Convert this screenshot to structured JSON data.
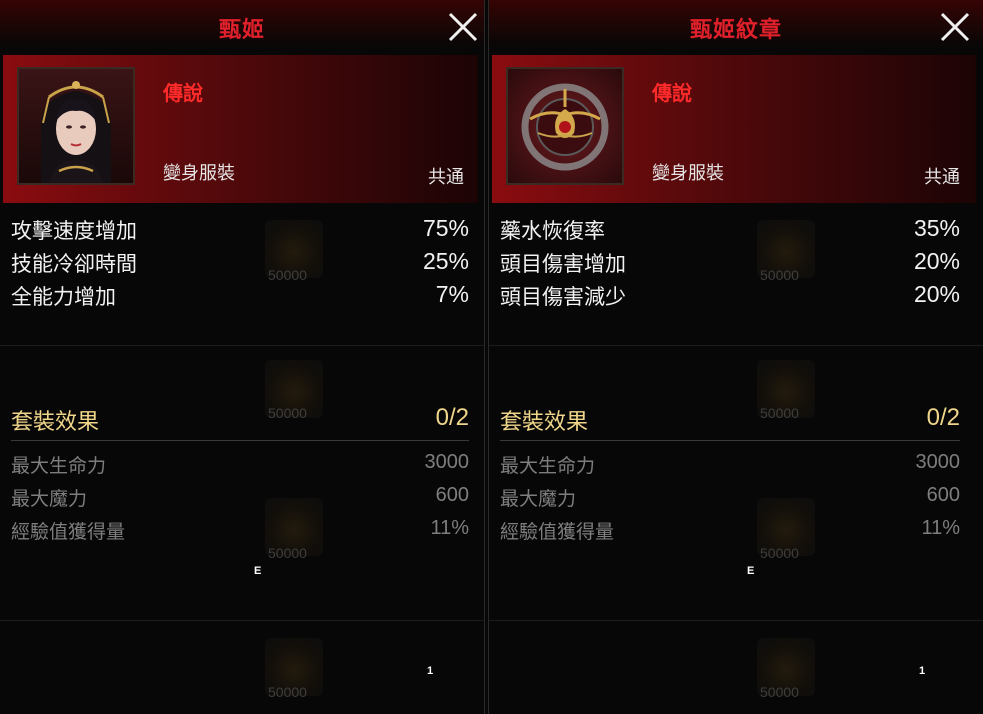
{
  "panels": [
    {
      "title": "甄姬",
      "rarity": "傳說",
      "category": "變身服裝",
      "scope": "共通",
      "portrait_icon": "consort-portrait-icon",
      "stats": [
        {
          "label": "攻擊速度增加",
          "value": "75%"
        },
        {
          "label": "技能冷卻時間",
          "value": "25%"
        },
        {
          "label": "全能力增加",
          "value": "7%"
        }
      ],
      "set_effect": {
        "label": "套裝效果",
        "progress": "0/2",
        "items": [
          {
            "label": "最大生命力",
            "value": "3000"
          },
          {
            "label": "最大魔力",
            "value": "600"
          },
          {
            "label": "經驗值獲得量",
            "value": "11%"
          }
        ]
      },
      "marks": [
        "E",
        "1"
      ]
    },
    {
      "title": "甄姬紋章",
      "rarity": "傳說",
      "category": "變身服裝",
      "scope": "共通",
      "portrait_icon": "emblem-crest-icon",
      "stats": [
        {
          "label": "藥水恢復率",
          "value": "35%"
        },
        {
          "label": "頭目傷害增加",
          "value": "20%"
        },
        {
          "label": "頭目傷害減少",
          "value": "20%"
        }
      ],
      "set_effect": {
        "label": "套裝效果",
        "progress": "0/2",
        "items": [
          {
            "label": "最大生命力",
            "value": "3000"
          },
          {
            "label": "最大魔力",
            "value": "600"
          },
          {
            "label": "經驗值獲得量",
            "value": "11%"
          }
        ]
      },
      "marks": [
        "E",
        "1"
      ]
    }
  ],
  "background": {
    "coin_value": "50000"
  },
  "colors": {
    "title_red": "#e0202a",
    "rarity_red": "#ff2a2a",
    "set_gold": "#f0d68a",
    "muted_grey": "#7e7e7e"
  }
}
